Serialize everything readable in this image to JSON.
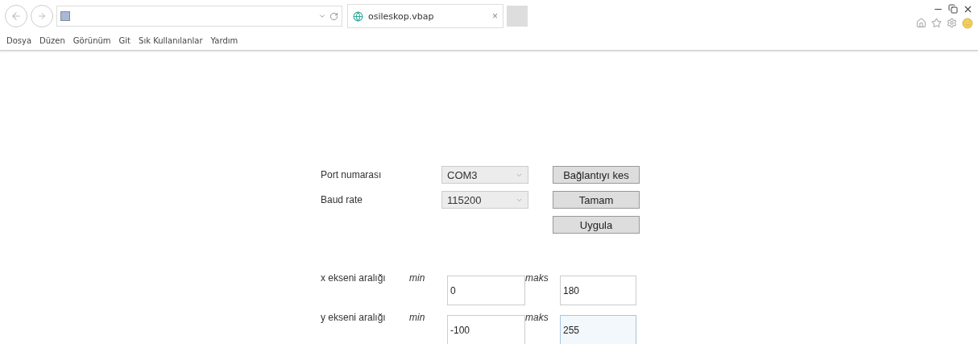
{
  "browser": {
    "tab": {
      "title": "osileskop.vbap",
      "close": "×"
    },
    "menu": [
      "Dosya",
      "Düzen",
      "Görünüm",
      "Git",
      "Sık Kullanılanlar",
      "Yardım"
    ]
  },
  "form": {
    "fields": [
      {
        "label": "Port numarası",
        "value": "COM3"
      },
      {
        "label": "Baud rate",
        "value": "115200"
      }
    ],
    "buttons": [
      "Bağlantıyı kes",
      "Tamam",
      "Uygula"
    ],
    "ranges": [
      {
        "label": "x ekseni aralığı",
        "min_label": "min",
        "min_value": "0",
        "max_label": "maks",
        "max_value": "180",
        "focused": false
      },
      {
        "label": "y ekseni aralığı",
        "min_label": "min",
        "min_value": "-100",
        "max_label": "maks",
        "max_value": "255",
        "focused": true
      }
    ]
  }
}
